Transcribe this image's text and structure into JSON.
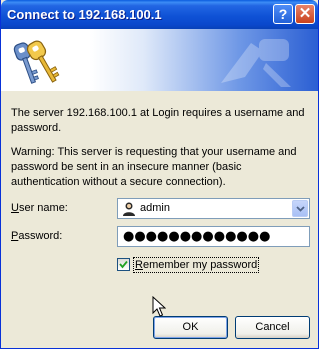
{
  "window": {
    "title": "Connect to 192.168.100.1",
    "help_label": "?",
    "close_label": "✕"
  },
  "message": {
    "line1": "The server 192.168.100.1 at Login requires a username and password.",
    "warning": "Warning: This server is requesting that your username and password be sent in an insecure manner (basic authentication without a secure connection)."
  },
  "form": {
    "username": {
      "label_hotkey": "U",
      "label_rest": "ser name:",
      "value": "admin"
    },
    "password": {
      "label_hotkey": "P",
      "label_rest": "assword:",
      "masked_value": "●●●●●●●●●●●●●"
    },
    "remember": {
      "label_hotkey": "R",
      "label_rest": "emember my password",
      "checked": true
    }
  },
  "buttons": {
    "ok_label": "OK",
    "cancel_label": "Cancel"
  },
  "colors": {
    "titlebar": "#0a48cc",
    "dialog_bg": "#ece9d8",
    "field_border": "#7f9db9"
  },
  "icons": {
    "banner": "keys-icon",
    "username_field": "user-icon",
    "dropdown": "chevron-down-icon"
  }
}
